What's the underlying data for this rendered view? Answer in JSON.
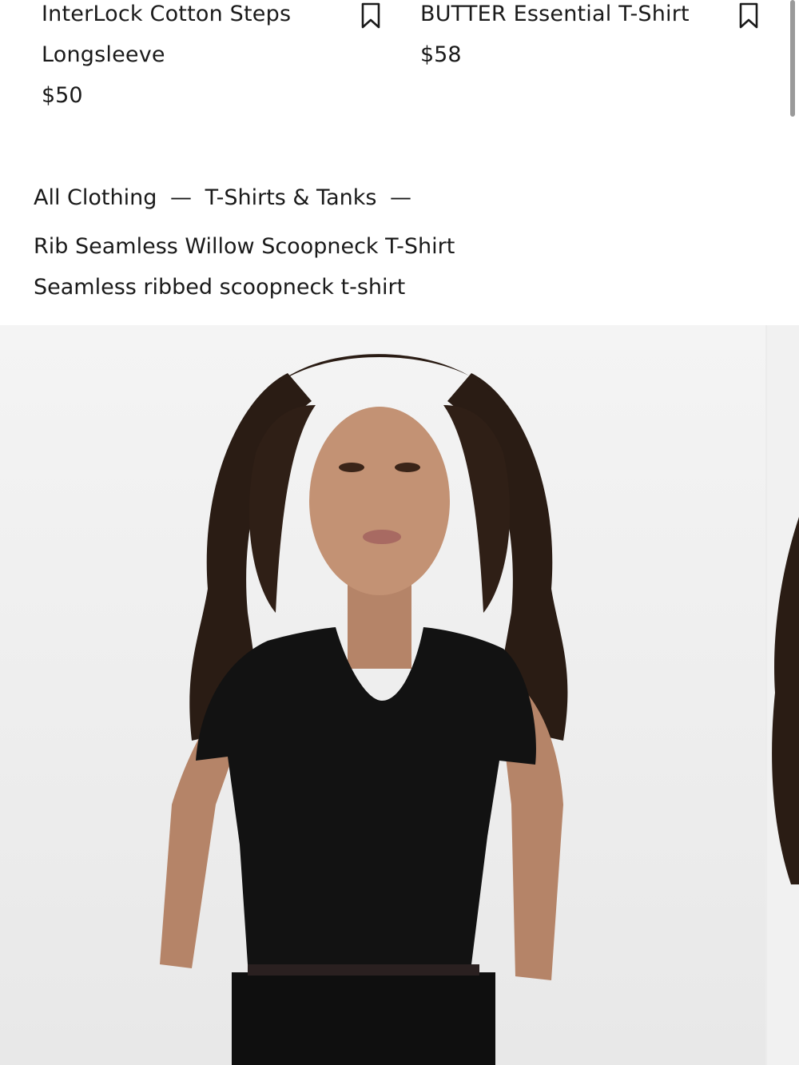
{
  "related_products": [
    {
      "name_line1": "InterLock Cotton Steps",
      "name_line2": "Longsleeve",
      "price": "$50",
      "bookmark_icon": "bookmark-icon"
    },
    {
      "name_line1": "BUTTER Essential T-Shirt",
      "price": "$58",
      "bookmark_icon": "bookmark-icon"
    }
  ],
  "breadcrumb": {
    "items": [
      "All Clothing",
      "T-Shirts & Tanks"
    ],
    "separator": "—"
  },
  "product": {
    "title": "Rib Seamless Willow Scoopneck T-Shirt",
    "subtitle": "Seamless ribbed scoopneck t-shirt",
    "image": "model wearing black ribbed scoopneck t-shirt"
  },
  "colors": {
    "text": "#1a1a1a",
    "garment": "#121212",
    "background": "#ffffff"
  }
}
